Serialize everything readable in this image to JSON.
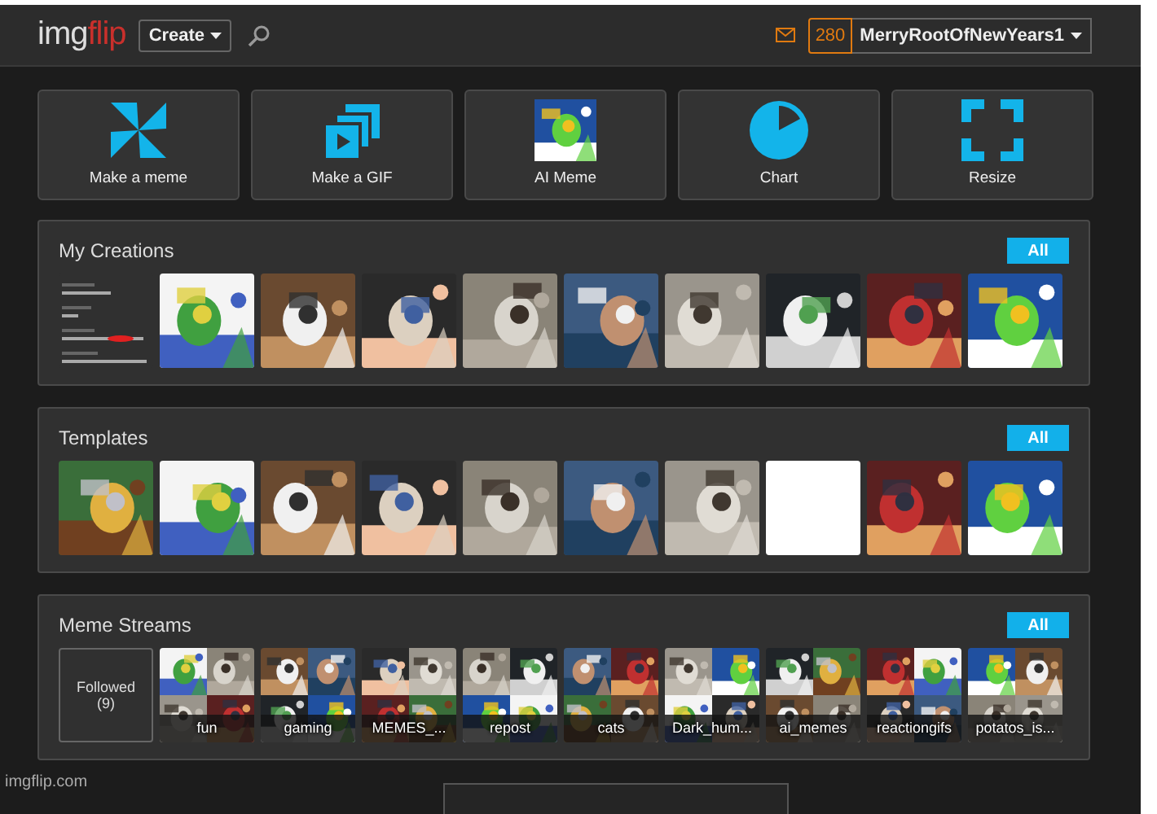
{
  "header": {
    "logo_prefix": "img",
    "logo_suffix": "flip",
    "create_label": "Create",
    "notification_count": "280",
    "username": "MerryRootOfNewYears1"
  },
  "tiles": [
    {
      "kind": "pinwheel",
      "label": "Make a meme"
    },
    {
      "kind": "gif",
      "label": "Make a GIF"
    },
    {
      "kind": "picture",
      "label": "AI Meme"
    },
    {
      "kind": "chart",
      "label": "Chart"
    },
    {
      "kind": "resize",
      "label": "Resize"
    }
  ],
  "sections": [
    {
      "title": "My Creations",
      "all_label": "All",
      "items": [
        {
          "kind": "feed"
        },
        {
          "kind": "picture"
        },
        {
          "kind": "picture"
        },
        {
          "kind": "picture"
        },
        {
          "kind": "picture"
        },
        {
          "kind": "picture"
        },
        {
          "kind": "picture"
        },
        {
          "kind": "picture"
        },
        {
          "kind": "picture"
        },
        {
          "kind": "picture"
        }
      ]
    },
    {
      "title": "Templates",
      "all_label": "All",
      "items": [
        {
          "kind": "picture"
        },
        {
          "kind": "picture"
        },
        {
          "kind": "picture"
        },
        {
          "kind": "picture"
        },
        {
          "kind": "picture"
        },
        {
          "kind": "picture"
        },
        {
          "kind": "picture"
        },
        {
          "kind": "blank"
        },
        {
          "kind": "picture"
        },
        {
          "kind": "picture"
        }
      ]
    },
    {
      "title": "Meme Streams",
      "all_label": "All",
      "items": [
        {
          "kind": "followed",
          "label": "Followed",
          "count": "(9)"
        },
        {
          "kind": "stream",
          "label": "fun"
        },
        {
          "kind": "stream",
          "label": "gaming"
        },
        {
          "kind": "stream",
          "label": "MEMES_..."
        },
        {
          "kind": "stream",
          "label": "repost"
        },
        {
          "kind": "stream",
          "label": "cats"
        },
        {
          "kind": "stream",
          "label": "Dark_hum..."
        },
        {
          "kind": "stream",
          "label": "ai_memes"
        },
        {
          "kind": "stream",
          "label": "reactiongifs"
        },
        {
          "kind": "stream",
          "label": "potatos_is..."
        }
      ]
    }
  ],
  "footer": {
    "domain": "imgflip.com"
  }
}
